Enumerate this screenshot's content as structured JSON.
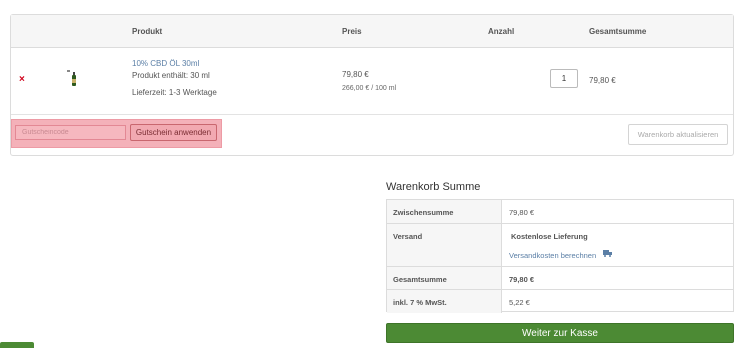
{
  "cart": {
    "headers": {
      "product": "Produkt",
      "price": "Preis",
      "quantity": "Anzahl",
      "subtotal": "Gesamtsumme"
    },
    "items": [
      {
        "name": "10% CBD ÖL 30ml",
        "content": "Produkt enthält: 30 ml",
        "delivery": "Lieferzeit: 1-3 Werktage",
        "price": "79,80 €",
        "unit_price": "266,00 € / 100 ml",
        "quantity": "1",
        "total": "79,80 €",
        "remove_icon": "×"
      }
    ],
    "coupon": {
      "placeholder": "Gutscheincode",
      "apply_label": "Gutschein anwenden"
    },
    "update_label": "Warenkorb aktualisieren"
  },
  "totals": {
    "title": "Warenkorb Summe",
    "subtotal_label": "Zwischensumme",
    "subtotal_value": "79,80 €",
    "shipping_label": "Versand",
    "shipping_value": "Kostenlose Lieferung",
    "shipping_link": "Versandkosten berechnen",
    "total_label": "Gesamtsumme",
    "total_value": "79,80 €",
    "tax_label": "inkl. 7 % MwSt.",
    "tax_value": "5,22 €"
  },
  "checkout_label": "Weiter zur Kasse",
  "colors": {
    "accent_green": "#4c8a34",
    "link_blue": "#5b7fa6",
    "remove_red": "#d0021b",
    "highlight_pink": "#f3a4ad"
  },
  "icons": {
    "remove": "close-icon",
    "shipping": "truck-icon",
    "product": "product-thumbnail"
  }
}
